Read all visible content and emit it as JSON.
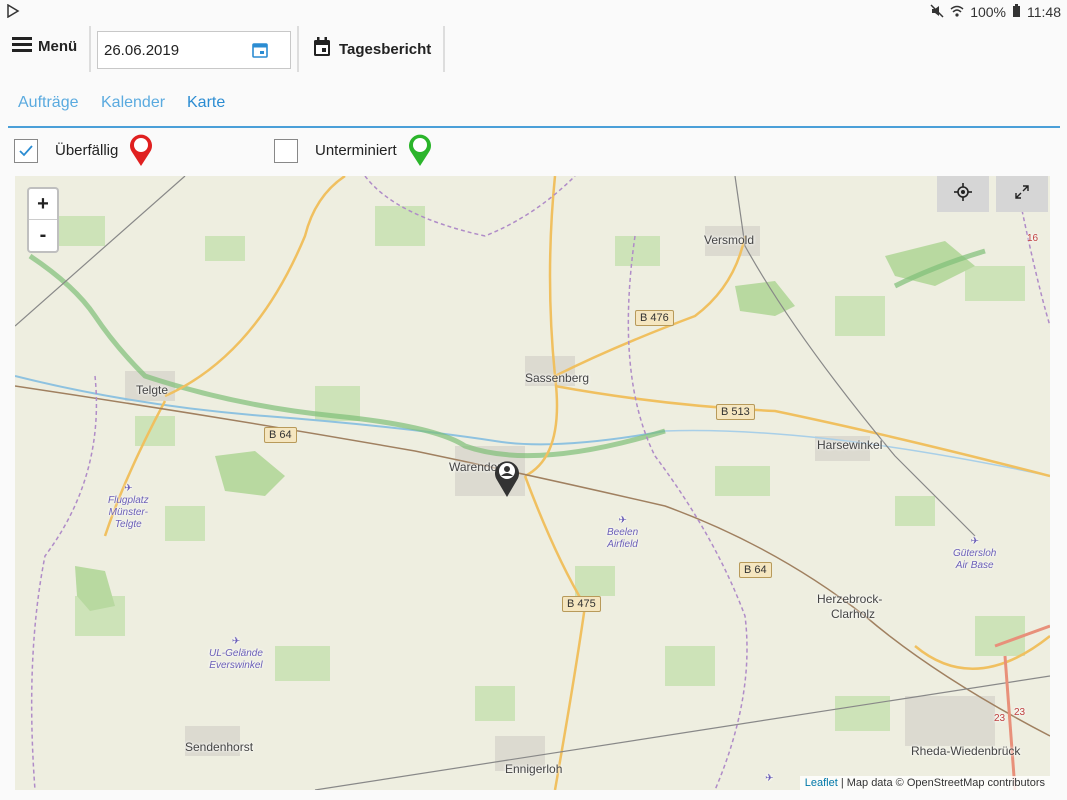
{
  "statusbar": {
    "battery": "100%",
    "time": "11:48"
  },
  "toolbar": {
    "menu_label": "Menü",
    "date_value": "26.06.2019",
    "report_label": "Tagesbericht"
  },
  "tabs": [
    {
      "label": "Aufträge"
    },
    {
      "label": "Kalender"
    },
    {
      "label": "Karte"
    }
  ],
  "filters": {
    "overdue": {
      "label": "Überfällig",
      "checked": true,
      "pin_color": "#e02020"
    },
    "unscheduled": {
      "label": "Unterminiert",
      "checked": false,
      "pin_color": "#2bb52b"
    }
  },
  "map": {
    "zoom_in": "+",
    "zoom_out": "-",
    "places": [
      "Versmold",
      "Sassenberg",
      "Telgte",
      "Warendorf",
      "Harsewinkel",
      "Herzebrock-",
      "Clarholz",
      "Sendenhorst",
      "Ennigerloh",
      "Rheda-Wiedenbrück"
    ],
    "airfields": [
      [
        "Flugplatz",
        "Münster-",
        "Telgte"
      ],
      [
        "Beelen",
        "Airfield"
      ],
      [
        "Gütersloh",
        "Air Base"
      ],
      [
        "UL-Gelände",
        "Everswinkel"
      ]
    ],
    "roads": [
      "B 476",
      "B 513",
      "B 64",
      "B 64",
      "B 475"
    ],
    "extra_labels": [
      "16",
      "23",
      "23"
    ],
    "attribution_link": "Leaflet",
    "attribution_text": " | Map data © OpenStreetMap contributors"
  },
  "colors": {
    "accent": "#2b8cd2",
    "tab_line": "#4a9fd8"
  }
}
